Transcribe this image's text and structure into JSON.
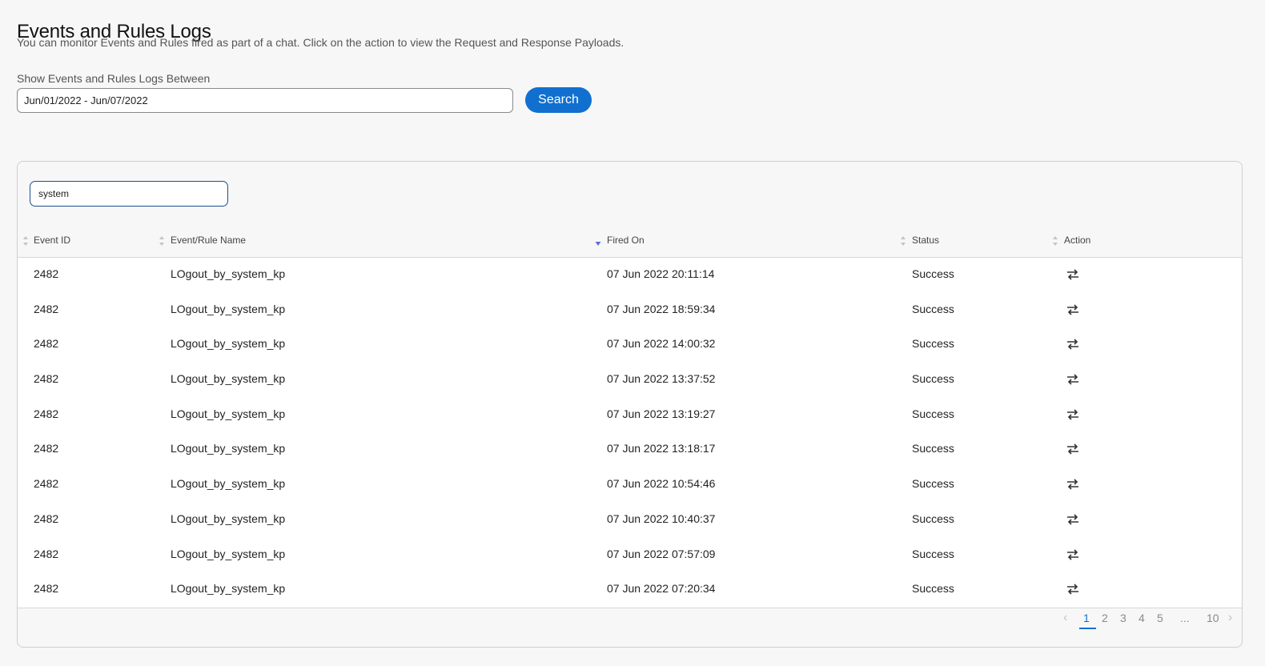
{
  "header": {
    "title": "Events and Rules Logs",
    "subtitle": "You can monitor Events and Rules fired as part of a chat. Click on the action to view the Request and Response Payloads."
  },
  "date_range": {
    "label": "Show Events and Rules Logs Between",
    "value": "Jun/01/2022 - Jun/07/2022",
    "search_label": "Search"
  },
  "filter": {
    "value": "system"
  },
  "table": {
    "columns": [
      "Event ID",
      "Event/Rule Name",
      "Fired On",
      "Status",
      "Action"
    ],
    "sorted_column": "Fired On",
    "sort_direction": "descending",
    "action_icon": "swap-arrows-icon",
    "rows": [
      {
        "event_id": "2482",
        "name": "LOgout_by_system_kp",
        "fired_on": "07 Jun 2022 20:11:14",
        "status": "Success"
      },
      {
        "event_id": "2482",
        "name": "LOgout_by_system_kp",
        "fired_on": "07 Jun 2022 18:59:34",
        "status": "Success"
      },
      {
        "event_id": "2482",
        "name": "LOgout_by_system_kp",
        "fired_on": "07 Jun 2022 14:00:32",
        "status": "Success"
      },
      {
        "event_id": "2482",
        "name": "LOgout_by_system_kp",
        "fired_on": "07 Jun 2022 13:37:52",
        "status": "Success"
      },
      {
        "event_id": "2482",
        "name": "LOgout_by_system_kp",
        "fired_on": "07 Jun 2022 13:19:27",
        "status": "Success"
      },
      {
        "event_id": "2482",
        "name": "LOgout_by_system_kp",
        "fired_on": "07 Jun 2022 13:18:17",
        "status": "Success"
      },
      {
        "event_id": "2482",
        "name": "LOgout_by_system_kp",
        "fired_on": "07 Jun 2022 10:54:46",
        "status": "Success"
      },
      {
        "event_id": "2482",
        "name": "LOgout_by_system_kp",
        "fired_on": "07 Jun 2022 10:40:37",
        "status": "Success"
      },
      {
        "event_id": "2482",
        "name": "LOgout_by_system_kp",
        "fired_on": "07 Jun 2022 07:57:09",
        "status": "Success"
      },
      {
        "event_id": "2482",
        "name": "LOgout_by_system_kp",
        "fired_on": "07 Jun 2022 07:20:34",
        "status": "Success"
      }
    ]
  },
  "pagination": {
    "pages": [
      "1",
      "2",
      "3",
      "4",
      "5",
      "...",
      "10"
    ],
    "current": "1"
  },
  "colors": {
    "accent": "#1170cf",
    "background": "#f7f7f7"
  }
}
